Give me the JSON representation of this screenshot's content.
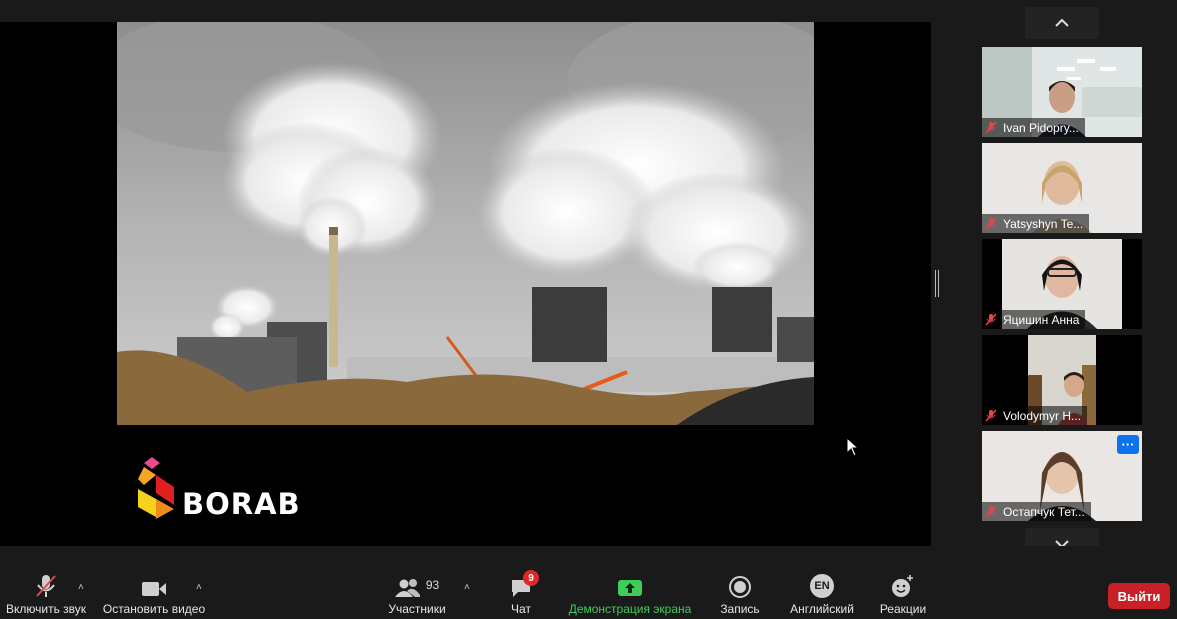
{
  "slide": {
    "photo_alt": "industrial smokestacks emitting white smoke",
    "logo_text": "BORAB"
  },
  "gallery": {
    "nav_up_icon": "chevron-up-icon",
    "nav_down_icon": "chevron-down-icon",
    "participants": [
      {
        "name": "Ivan Pidopry...",
        "muted": true
      },
      {
        "name": "Yatsyshyn Te...",
        "muted": true
      },
      {
        "name": "Яцишин Анна",
        "muted": true
      },
      {
        "name": "Volodymyr H...",
        "muted": true
      },
      {
        "name": "Остапчук Тет...",
        "muted": true,
        "more": "···"
      }
    ]
  },
  "toolbar": {
    "unmute_label": "Включить звук",
    "stop_video_label": "Остановить видео",
    "participants_label": "Участники",
    "participants_count": "93",
    "chat_label": "Чат",
    "chat_badge": "9",
    "share_label": "Демонстрация экрана",
    "record_label": "Запись",
    "language_label": "Английский",
    "language_code": "EN",
    "reactions_label": "Реакции",
    "exit_label": "Выйти"
  },
  "colors": {
    "share_accent": "#3fcc5a",
    "exit_bg": "#c92027",
    "muted_red": "#e0474d",
    "tile_menu_blue": "#0e72ed"
  }
}
